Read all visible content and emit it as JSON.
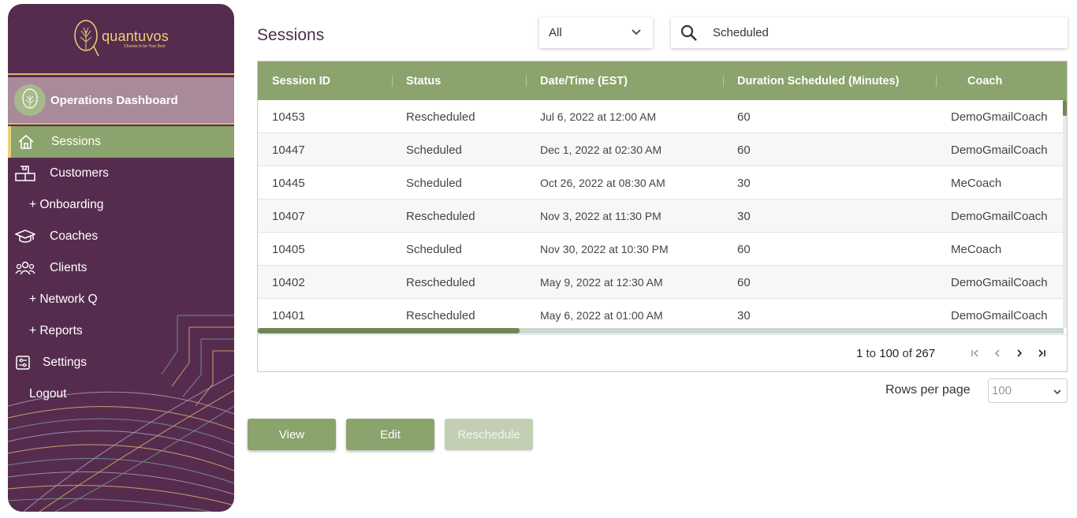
{
  "brand": {
    "name": "quantuvos",
    "tagline": "Choose to be Your Best"
  },
  "sidebar": {
    "dashboard_label": "Operations Dashboard",
    "items": [
      {
        "label": "Sessions",
        "icon": "home-icon",
        "active": true
      },
      {
        "label": "Customers",
        "icon": "boxes-icon"
      },
      {
        "label": "+ Onboarding"
      },
      {
        "label": "Coaches",
        "icon": "graduation-cap-icon"
      },
      {
        "label": "Clients",
        "icon": "users-icon"
      },
      {
        "label": "+ Network Q"
      },
      {
        "label": "+ Reports"
      },
      {
        "label": "Settings",
        "icon": "sliders-icon"
      },
      {
        "label": "Logout"
      }
    ]
  },
  "page": {
    "title": "Sessions"
  },
  "filter": {
    "value": "All"
  },
  "search": {
    "value": "Scheduled"
  },
  "table": {
    "columns": [
      "Session ID",
      "Status",
      "Date/Time (EST)",
      "Duration Scheduled (Minutes)",
      "Coach"
    ],
    "rows": [
      [
        "10453",
        "Rescheduled",
        "Jul 6, 2022 at 12:00 AM",
        "60",
        "DemoGmailCoach"
      ],
      [
        "10447",
        "Scheduled",
        "Dec 1, 2022 at 02:30 AM",
        "60",
        "DemoGmailCoach"
      ],
      [
        "10445",
        "Scheduled",
        "Oct 26, 2022 at 08:30 AM",
        "30",
        "MeCoach"
      ],
      [
        "10407",
        "Rescheduled",
        "Nov 3, 2022 at 11:30 PM",
        "30",
        "DemoGmailCoach"
      ],
      [
        "10405",
        "Scheduled",
        "Nov 30, 2022 at 10:30 PM",
        "60",
        "MeCoach"
      ],
      [
        "10402",
        "Rescheduled",
        "May 9, 2022 at 12:30 AM",
        "60",
        "DemoGmailCoach"
      ],
      [
        "10401",
        "Rescheduled",
        "May 6, 2022 at 01:00 AM",
        "30",
        "DemoGmailCoach"
      ]
    ]
  },
  "pagination": {
    "from": "1",
    "to_word": "to",
    "to": "100",
    "of_word": "of",
    "total": "267"
  },
  "rows_per_page": {
    "label": "Rows per page",
    "value": "100"
  },
  "actions": {
    "view": "View",
    "edit": "Edit",
    "reschedule": "Reschedule"
  },
  "colors": {
    "sidebar": "#562c4e",
    "accent": "#8ba36d",
    "gold": "#e8d27a"
  }
}
